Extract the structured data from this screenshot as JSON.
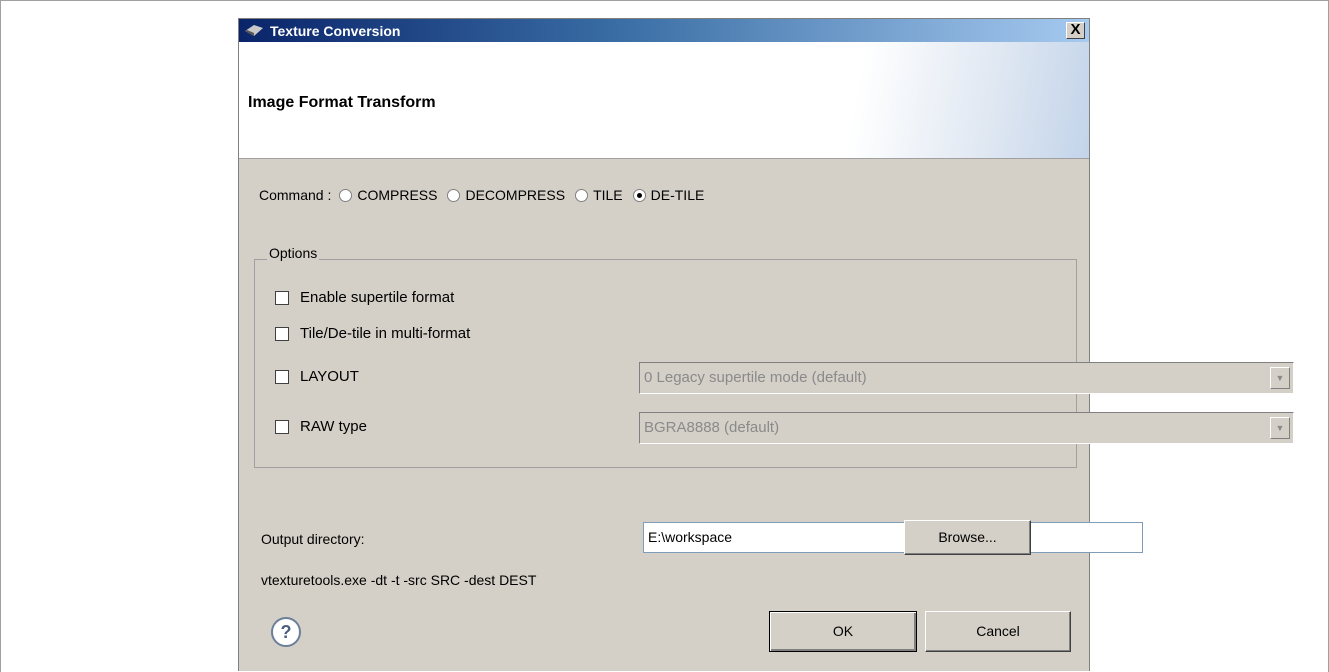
{
  "dialog": {
    "title": "Texture Conversion",
    "close_label": "X",
    "banner_title": "Image Format Transform"
  },
  "command": {
    "label": "Command :",
    "options": [
      {
        "label": "COMPRESS",
        "selected": false
      },
      {
        "label": "DECOMPRESS",
        "selected": false
      },
      {
        "label": "TILE",
        "selected": false
      },
      {
        "label": "DE-TILE",
        "selected": true
      }
    ]
  },
  "options_group": {
    "legend": "Options",
    "supertile": {
      "label": "Enable supertile format",
      "checked": false
    },
    "multiformat": {
      "label": "Tile/De-tile in multi-format",
      "checked": false
    },
    "layout": {
      "label": "LAYOUT",
      "checked": false,
      "selected_value": "0 Legacy supertile mode (default)",
      "enabled": false
    },
    "raw_type": {
      "label": "RAW type",
      "checked": false,
      "selected_value": "BGRA8888 (default)",
      "enabled": false
    }
  },
  "output": {
    "label": "Output directory:",
    "value": "E:\\workspace",
    "browse_label": "Browse..."
  },
  "command_preview": "vtexturetools.exe -dt -t -src SRC -dest DEST",
  "footer": {
    "help_glyph": "?",
    "ok_label": "OK",
    "cancel_label": "Cancel"
  }
}
